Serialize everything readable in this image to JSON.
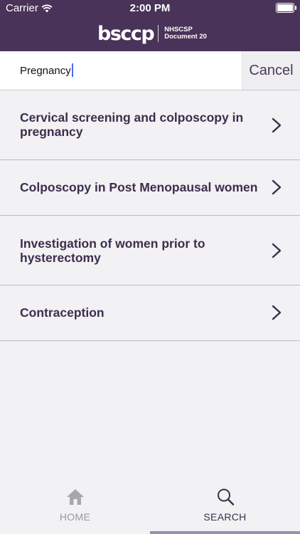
{
  "status_bar": {
    "carrier": "Carrier",
    "time": "2:00 PM"
  },
  "header": {
    "logo_word": "bsccp",
    "logo_line1": "NHSCSP",
    "logo_line2": "Document 20"
  },
  "search": {
    "value": "Pregnancy",
    "cancel_label": "Cancel"
  },
  "results": [
    {
      "label": "Cervical screening and colposcopy in pregnancy"
    },
    {
      "label": "Colposcopy in Post Menopausal women"
    },
    {
      "label": "Investigation of women prior to hysterectomy"
    },
    {
      "label": "Contraception"
    }
  ],
  "tabs": [
    {
      "label": "HOME",
      "icon": "home-icon",
      "selected": false
    },
    {
      "label": "SEARCH",
      "icon": "search-icon",
      "selected": true
    }
  ],
  "colors": {
    "header": "#4a3358",
    "text": "#3c2e4e",
    "background": "#f2f1f3",
    "tab_indicator": "#9a8fb3"
  }
}
